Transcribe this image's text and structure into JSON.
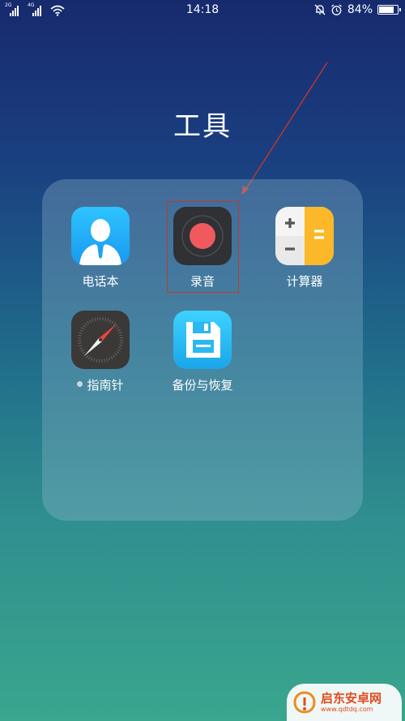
{
  "status_bar": {
    "sim1_tag": "2G",
    "sim2_tag": "4G",
    "time": "14:18",
    "battery_percent": "84%",
    "battery_level": 0.84
  },
  "folder": {
    "title": "工具",
    "apps": [
      {
        "label": "电话本",
        "icon": "contacts-icon"
      },
      {
        "label": "录音",
        "icon": "recorder-icon"
      },
      {
        "label": "计算器",
        "icon": "calculator-icon"
      },
      {
        "label": "指南针",
        "icon": "compass-icon",
        "has_new_dot": true
      },
      {
        "label": "备份与恢复",
        "icon": "backup-icon"
      }
    ]
  },
  "annotation": {
    "highlight_color": "#c0392b"
  },
  "watermark": {
    "title": "启东安卓网",
    "url": "www.qdtdq.com"
  }
}
